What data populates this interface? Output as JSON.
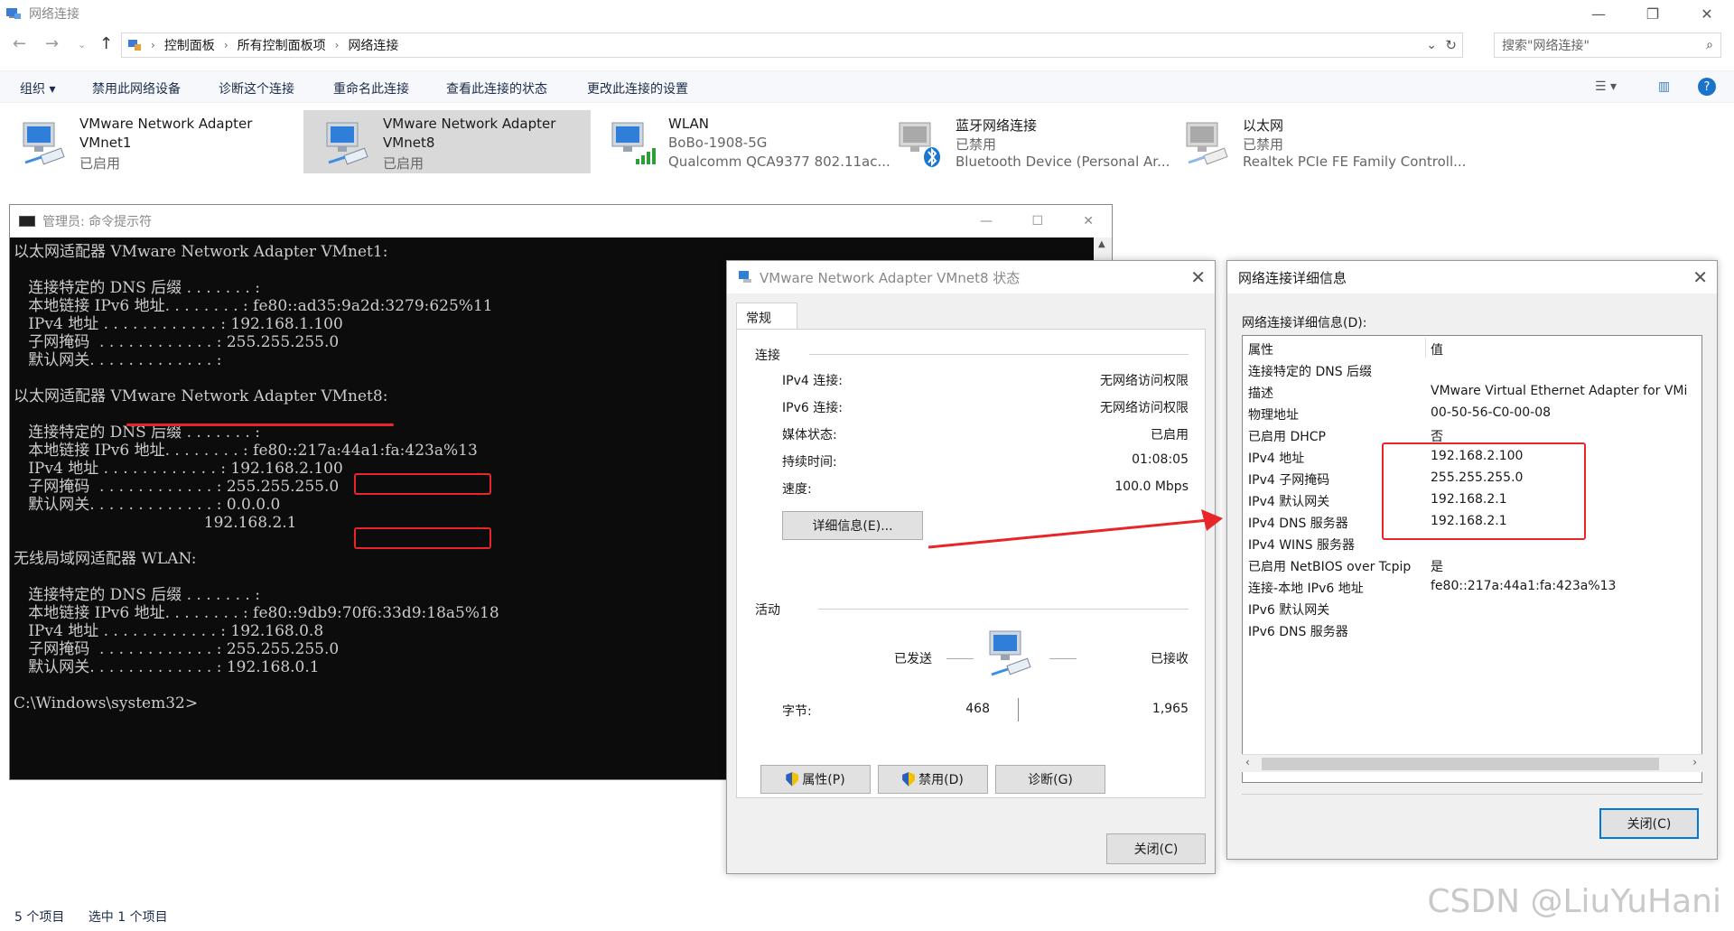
{
  "explorer": {
    "title": "网络连接",
    "breadcrumb": [
      "控制面板",
      "所有控制面板项",
      "网络连接"
    ],
    "search_placeholder": "搜索\"网络连接\"",
    "toolbar": [
      "组织 ▾",
      "禁用此网络设备",
      "诊断这个连接",
      "重命名此连接",
      "查看此连接的状态",
      "更改此连接的设置"
    ],
    "adapters": [
      {
        "name": "VMware Network Adapter",
        "line2": "VMnet1",
        "line3": "已启用"
      },
      {
        "name": "VMware Network Adapter",
        "line2": "VMnet8",
        "line3": "已启用"
      },
      {
        "name": "WLAN",
        "line2": "BoBo-1908-5G",
        "line3": "Qualcomm QCA9377 802.11ac..."
      },
      {
        "name": "蓝牙网络连接",
        "line2": "已禁用",
        "line3": "Bluetooth Device (Personal Ar..."
      },
      {
        "name": "以太网",
        "line2": "已禁用",
        "line3": "Realtek PCIe FE Family Controll..."
      }
    ],
    "status": {
      "count": "5 个项目",
      "selected": "选中 1 个项目"
    }
  },
  "cmd": {
    "title": "管理员: 命令提示符",
    "lines": [
      "以太网适配器 VMware Network Adapter VMnet1:",
      "",
      "   连接特定的 DNS 后缀 . . . . . . . :",
      "   本地链接 IPv6 地址. . . . . . . . : fe80::ad35:9a2d:3279:625%11",
      "   IPv4 地址 . . . . . . . . . . . . : 192.168.1.100",
      "   子网掩码  . . . . . . . . . . . . : 255.255.255.0",
      "   默认网关. . . . . . . . . . . . . :",
      "",
      "以太网适配器 VMware Network Adapter VMnet8:",
      "",
      "   连接特定的 DNS 后缀 . . . . . . . :",
      "   本地链接 IPv6 地址. . . . . . . . : fe80::217a:44a1:fa:423a%13",
      "   IPv4 地址 . . . . . . . . . . . . : 192.168.2.100",
      "   子网掩码  . . . . . . . . . . . . : 255.255.255.0",
      "   默认网关. . . . . . . . . . . . . : 0.0.0.0",
      "                                       192.168.2.1",
      "",
      "无线局域网适配器 WLAN:",
      "",
      "   连接特定的 DNS 后缀 . . . . . . . :",
      "   本地链接 IPv6 地址. . . . . . . . : fe80::9db9:70f6:33d9:18a5%18",
      "   IPv4 地址 . . . . . . . . . . . . : 192.168.0.8",
      "   子网掩码  . . . . . . . . . . . . : 255.255.255.0",
      "   默认网关. . . . . . . . . . . . . : 192.168.0.1",
      "",
      "C:\\Windows\\system32>"
    ]
  },
  "status_dialog": {
    "title": "VMware Network Adapter VMnet8 状态",
    "tab": "常规",
    "connection_group": "连接",
    "rows": [
      {
        "k": "IPv4 连接:",
        "v": "无网络访问权限"
      },
      {
        "k": "IPv6 连接:",
        "v": "无网络访问权限"
      },
      {
        "k": "媒体状态:",
        "v": "已启用"
      },
      {
        "k": "持续时间:",
        "v": "01:08:05"
      },
      {
        "k": "速度:",
        "v": "100.0 Mbps"
      }
    ],
    "details_button": "详细信息(E)...",
    "activity_group": "活动",
    "sent_label": "已发送",
    "received_label": "已接收",
    "bytes_label": "字节:",
    "bytes_sent": "468",
    "bytes_received": "1,965",
    "properties_button": "属性(P)",
    "disable_button": "禁用(D)",
    "diagnose_button": "诊断(G)",
    "close_button": "关闭(C)"
  },
  "detail_dialog": {
    "title": "网络连接详细信息",
    "list_label": "网络连接详细信息(D):",
    "col_property": "属性",
    "col_value": "值",
    "rows": [
      {
        "p": "连接特定的 DNS 后缀",
        "v": ""
      },
      {
        "p": "描述",
        "v": "VMware Virtual Ethernet Adapter for VMi"
      },
      {
        "p": "物理地址",
        "v": "00-50-56-C0-00-08"
      },
      {
        "p": "已启用 DHCP",
        "v": "否"
      },
      {
        "p": "IPv4 地址",
        "v": "192.168.2.100"
      },
      {
        "p": "IPv4 子网掩码",
        "v": "255.255.255.0"
      },
      {
        "p": "IPv4 默认网关",
        "v": "192.168.2.1"
      },
      {
        "p": "IPv4 DNS 服务器",
        "v": "192.168.2.1"
      },
      {
        "p": "IPv4 WINS 服务器",
        "v": ""
      },
      {
        "p": "已启用 NetBIOS over Tcpip",
        "v": "是"
      },
      {
        "p": "连接-本地 IPv6 地址",
        "v": "fe80::217a:44a1:fa:423a%13"
      },
      {
        "p": "IPv6 默认网关",
        "v": ""
      },
      {
        "p": "IPv6 DNS 服务器",
        "v": ""
      }
    ],
    "close_button": "关闭(C)"
  },
  "watermark": "CSDN @LiuYuHani",
  "colors": {
    "annotation": "#e8262a",
    "accent": "#0078d7"
  }
}
